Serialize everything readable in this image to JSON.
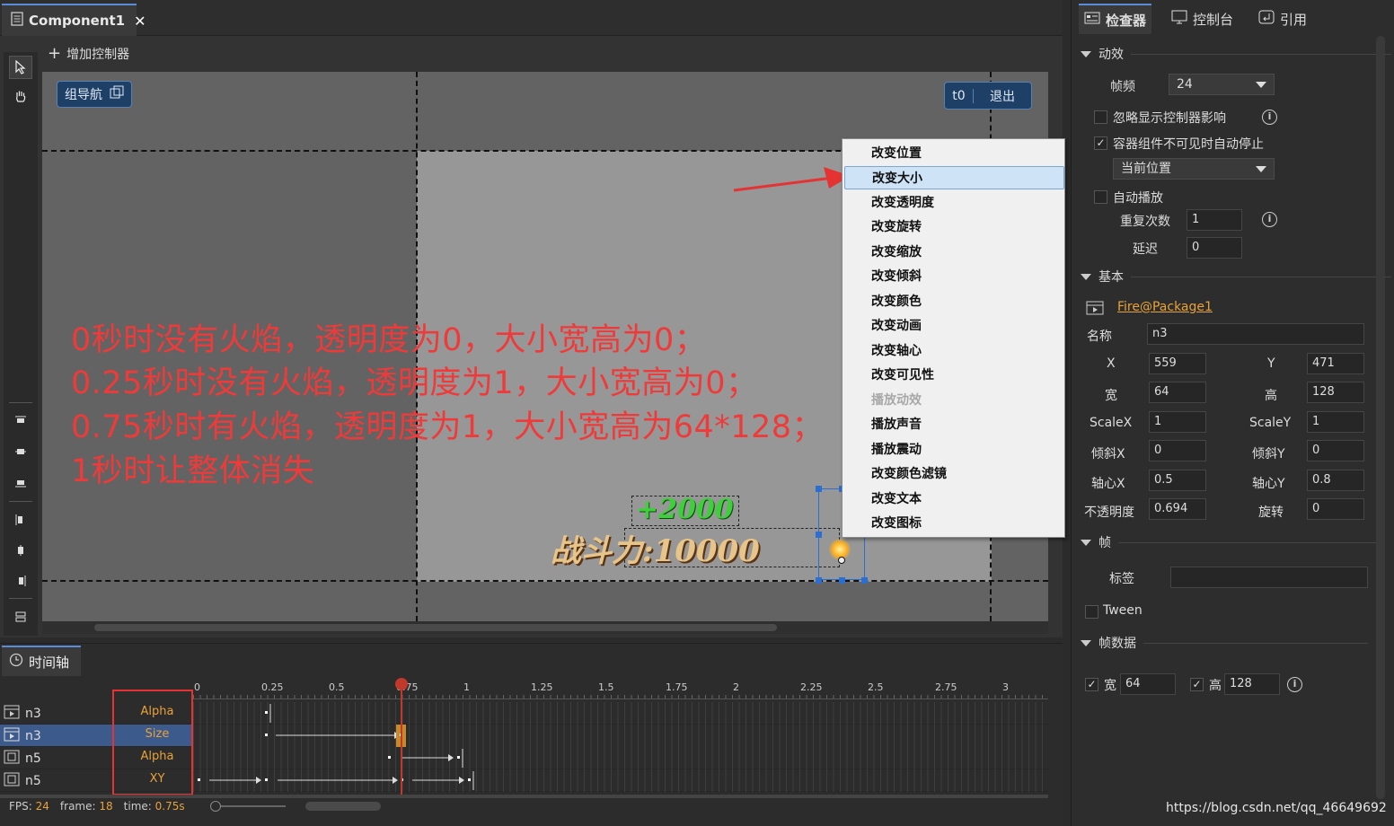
{
  "document_tab": {
    "title": "Component1",
    "close": "✕"
  },
  "controller_bar": {
    "add_label": "增加控制器"
  },
  "stage": {
    "group_nav": "组导航",
    "controller_name": "t0",
    "exit": "退出",
    "annotations": [
      "0秒时没有火焰，透明度为0，大小宽高为0；",
      "0.25秒时没有火焰，透明度为1，大小宽高为0；",
      "0.75秒时有火焰，透明度为1，大小宽高为64*128；",
      "1秒时让整体消失"
    ],
    "bonus_text": "+2000",
    "power_text": "战斗力:10000"
  },
  "context_menu": {
    "items": [
      {
        "label": "改变位置",
        "state": "normal"
      },
      {
        "label": "改变大小",
        "state": "highlighted"
      },
      {
        "label": "改变透明度",
        "state": "normal"
      },
      {
        "label": "改变旋转",
        "state": "normal"
      },
      {
        "label": "改变缩放",
        "state": "normal"
      },
      {
        "label": "改变倾斜",
        "state": "normal"
      },
      {
        "label": "改变颜色",
        "state": "normal"
      },
      {
        "label": "改变动画",
        "state": "normal"
      },
      {
        "label": "改变轴心",
        "state": "normal"
      },
      {
        "label": "改变可见性",
        "state": "normal"
      },
      {
        "label": "播放动效",
        "state": "disabled"
      },
      {
        "label": "播放声音",
        "state": "normal"
      },
      {
        "label": "播放震动",
        "state": "normal"
      },
      {
        "label": "改变颜色滤镜",
        "state": "normal"
      },
      {
        "label": "改变文本",
        "state": "normal"
      },
      {
        "label": "改变图标",
        "state": "normal"
      }
    ]
  },
  "timeline": {
    "tab_label": "时间轴",
    "ruler_labels": [
      "0",
      "0.25",
      "0.5",
      "0.75",
      "1",
      "1.25",
      "1.5",
      "1.75",
      "2",
      "2.25",
      "2.5",
      "2.75",
      "3"
    ],
    "tracks": [
      {
        "name": "n3",
        "property": "Alpha",
        "selected": false
      },
      {
        "name": "n3",
        "property": "Size",
        "selected": true
      },
      {
        "name": "n5",
        "property": "Alpha",
        "selected": false
      },
      {
        "name": "n5",
        "property": "XY",
        "selected": false
      }
    ],
    "status": {
      "fps_label": "FPS:",
      "fps": "24",
      "frame_label": "frame:",
      "frame": "18",
      "time_label": "time:",
      "time": "0.75s"
    }
  },
  "inspector": {
    "tabs": [
      "检查器",
      "控制台",
      "引用"
    ],
    "effects": {
      "title": "动效",
      "fps_label": "帧频",
      "fps_value": "24",
      "ignore_ctrl_label": "忽略显示控制器影响",
      "ignore_ctrl_checked": false,
      "auto_stop_label": "容器组件不可见时自动停止",
      "auto_stop_checked": true,
      "position_value": "当前位置",
      "autoplay_label": "自动播放",
      "autoplay_checked": false,
      "repeat_label": "重复次数",
      "repeat_value": "1",
      "delay_label": "延迟",
      "delay_value": "0"
    },
    "basic": {
      "title": "基本",
      "resource": "Fire@Package1",
      "name_label": "名称",
      "name_value": "n3",
      "x_label": "X",
      "x_value": "559",
      "y_label": "Y",
      "y_value": "471",
      "w_label": "宽",
      "w_value": "64",
      "h_label": "高",
      "h_value": "128",
      "sx_label": "ScaleX",
      "sx_value": "1",
      "sy_label": "ScaleY",
      "sy_value": "1",
      "skx_label": "倾斜X",
      "skx_value": "0",
      "sky_label": "倾斜Y",
      "sky_value": "0",
      "px_label": "轴心X",
      "px_value": "0.5",
      "py_label": "轴心Y",
      "py_value": "0.8",
      "alpha_label": "不透明度",
      "alpha_value": "0.694",
      "rot_label": "旋转",
      "rot_value": "0"
    },
    "frame": {
      "title": "帧",
      "tag_label": "标签",
      "tag_value": "",
      "tween_label": "Tween",
      "tween_checked": false
    },
    "frame_data": {
      "title": "帧数据",
      "w_label": "宽",
      "w_value": "64",
      "h_label": "高",
      "h_value": "128"
    }
  },
  "watermark": "https://blog.csdn.net/qq_46649692",
  "colors": {
    "annotation_red": "#f03a3a",
    "accent_blue": "#5a8bd6",
    "keyframe_orange": "#e8a23a",
    "highlight": "#cfe3f7"
  }
}
